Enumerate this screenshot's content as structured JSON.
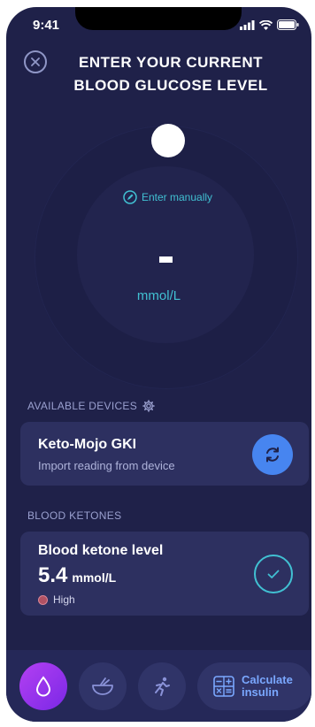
{
  "status_bar": {
    "time": "9:41"
  },
  "header": {
    "title": "ENTER YOUR CURRENT BLOOD GLUCOSE LEVEL"
  },
  "dial": {
    "enter_manually_label": "Enter manually",
    "value": "-",
    "unit": "mmol/L"
  },
  "devices": {
    "section_label": "AVAILABLE DEVICES",
    "card": {
      "name": "Keto-Mojo GKI",
      "subtitle": "Import reading from device"
    }
  },
  "ketones": {
    "section_label": "BLOOD KETONES",
    "card": {
      "title": "Blood ketone level",
      "value": "5.4",
      "unit": "mmol/L",
      "status": "High"
    }
  },
  "tabbar": {
    "calculate_label": "Calculate insulin"
  },
  "colors": {
    "background": "#1f2149",
    "accent_cyan": "#41c0d2",
    "sync_blue": "#4785f0",
    "active_tab": "#9b35ec",
    "status_high": "#b05163"
  },
  "icons": [
    "close-icon",
    "edit-icon",
    "gear-icon",
    "sync-icon",
    "check-icon",
    "drop-icon",
    "bowl-icon",
    "run-icon",
    "calculator-icon"
  ]
}
